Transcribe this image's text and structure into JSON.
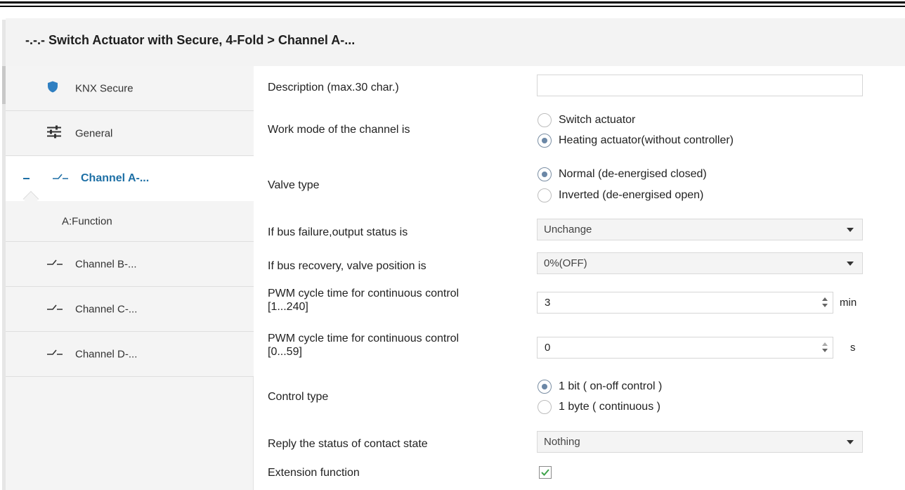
{
  "window": {
    "breadcrumb": "-.-.- Switch Actuator with Secure, 4-Fold > Channel A-..."
  },
  "sidebar": {
    "items": [
      {
        "label": "KNX Secure",
        "icon": "shield-icon"
      },
      {
        "label": "General",
        "icon": "sliders-icon"
      },
      {
        "label": "Channel A-...",
        "icon": "switch-contact-icon",
        "active": true,
        "expanded": true
      },
      {
        "label": "A:Function"
      },
      {
        "label": "Channel B-...",
        "icon": "switch-contact-icon"
      },
      {
        "label": "Channel C-...",
        "icon": "switch-contact-icon"
      },
      {
        "label": "Channel D-...",
        "icon": "switch-contact-icon"
      }
    ]
  },
  "params": {
    "description": {
      "label": "Description (max.30 char.)",
      "value": ""
    },
    "work_mode": {
      "label": "Work mode of the channel is",
      "options": [
        "Switch actuator",
        "Heating actuator(without controller)"
      ],
      "selected": 1
    },
    "valve_type": {
      "label": "Valve type",
      "options": [
        "Normal (de-energised closed)",
        "Inverted (de-energised open)"
      ],
      "selected": 0
    },
    "bus_failure": {
      "label": "If bus failure,output status is",
      "value": "Unchange"
    },
    "bus_recovery": {
      "label": "If bus recovery, valve position is",
      "value": "0%(OFF)"
    },
    "pwm_min": {
      "label_line1": "PWM cycle time for continuous control",
      "label_line2": "[1...240]",
      "value": "3",
      "unit": "min"
    },
    "pwm_s": {
      "label_line1": "PWM cycle time for continuous control",
      "label_line2": "[0...59]",
      "value": "0",
      "unit": "s"
    },
    "control_type": {
      "label": "Control type",
      "options": [
        "1 bit ( on-off control )",
        "1 byte ( continuous )"
      ],
      "selected": 0
    },
    "reply_status": {
      "label": "Reply the status of contact state",
      "value": "Nothing"
    },
    "extension": {
      "label": "Extension function",
      "checked": true
    }
  },
  "colors": {
    "accent": "#1d6fa5",
    "shield": "#2f7fc1",
    "radio_dot": "#6b87a6",
    "check": "#3ea34a"
  }
}
